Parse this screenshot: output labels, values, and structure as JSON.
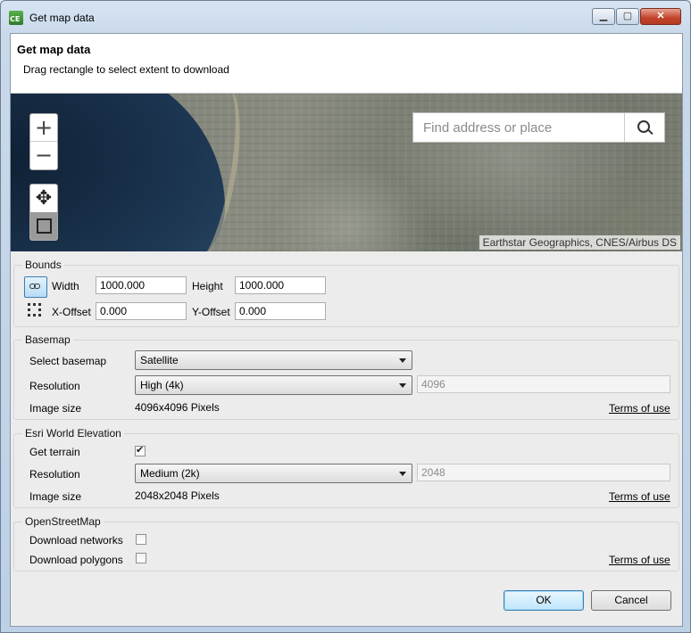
{
  "window": {
    "title": "Get map data",
    "icon_name": "app-icon",
    "icon_text": "CE",
    "controls": {
      "minimize": "▁",
      "maximize": "▢",
      "close": "✕"
    }
  },
  "header": {
    "title": "Get map data",
    "description": "Drag rectangle to select extent to download"
  },
  "map": {
    "search_placeholder": "Find address or place",
    "attribution": "Earthstar Geographics, CNES/Airbus DS",
    "zoom_in": "+",
    "zoom_out": "−",
    "pan_tool": "✥"
  },
  "bounds": {
    "legend": "Bounds",
    "width_label": "Width",
    "width_value": "1000.000",
    "height_label": "Height",
    "height_value": "1000.000",
    "xoffset_label": "X-Offset",
    "xoffset_value": "0.000",
    "yoffset_label": "Y-Offset",
    "yoffset_value": "0.000"
  },
  "basemap": {
    "legend": "Basemap",
    "select_label": "Select basemap",
    "select_value": "Satellite",
    "resolution_label": "Resolution",
    "resolution_value": "High (4k)",
    "resolution_pixels": "4096",
    "image_size_label": "Image size",
    "image_size_value": "4096x4096 Pixels",
    "terms": "Terms of use"
  },
  "elevation": {
    "legend": "Esri World Elevation",
    "get_terrain_label": "Get terrain",
    "get_terrain_checked": true,
    "resolution_label": "Resolution",
    "resolution_value": "Medium (2k)",
    "resolution_pixels": "2048",
    "image_size_label": "Image size",
    "image_size_value": "2048x2048 Pixels",
    "terms": "Terms of use"
  },
  "osm": {
    "legend": "OpenStreetMap",
    "networks_label": "Download networks",
    "networks_checked": false,
    "polygons_label": "Download polygons",
    "polygons_checked": false,
    "terms": "Terms of use"
  },
  "footer": {
    "ok": "OK",
    "cancel": "Cancel"
  }
}
